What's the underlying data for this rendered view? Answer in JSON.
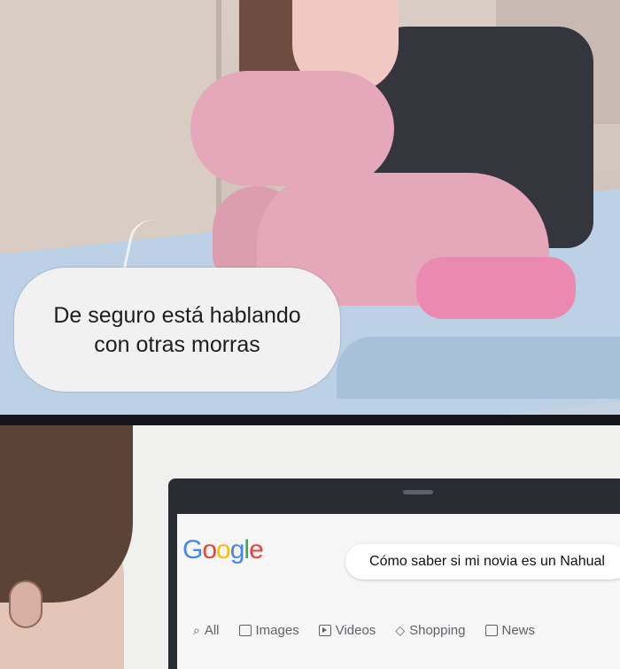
{
  "comic": {
    "speech_bubble": {
      "line1": "De seguro está hablando",
      "line2": "con otras morras"
    }
  },
  "browser": {
    "logo": [
      "G",
      "o",
      "o",
      "g",
      "l",
      "e"
    ],
    "search_query": "Cómo saber si mi novia es un Nahual",
    "tabs": [
      {
        "label": "All",
        "icon": "search-icon",
        "active": true
      },
      {
        "label": "Images",
        "icon": "image-icon",
        "active": false
      },
      {
        "label": "Videos",
        "icon": "video-icon",
        "active": false
      },
      {
        "label": "Shopping",
        "icon": "tag-icon",
        "active": false
      },
      {
        "label": "News",
        "icon": "newspaper-icon",
        "active": false
      }
    ],
    "colors": {
      "accent": "#1a73e8",
      "logo_blue": "#4285f4",
      "logo_red": "#ea4335",
      "logo_yellow": "#fbbc05",
      "logo_green": "#34a853"
    }
  }
}
